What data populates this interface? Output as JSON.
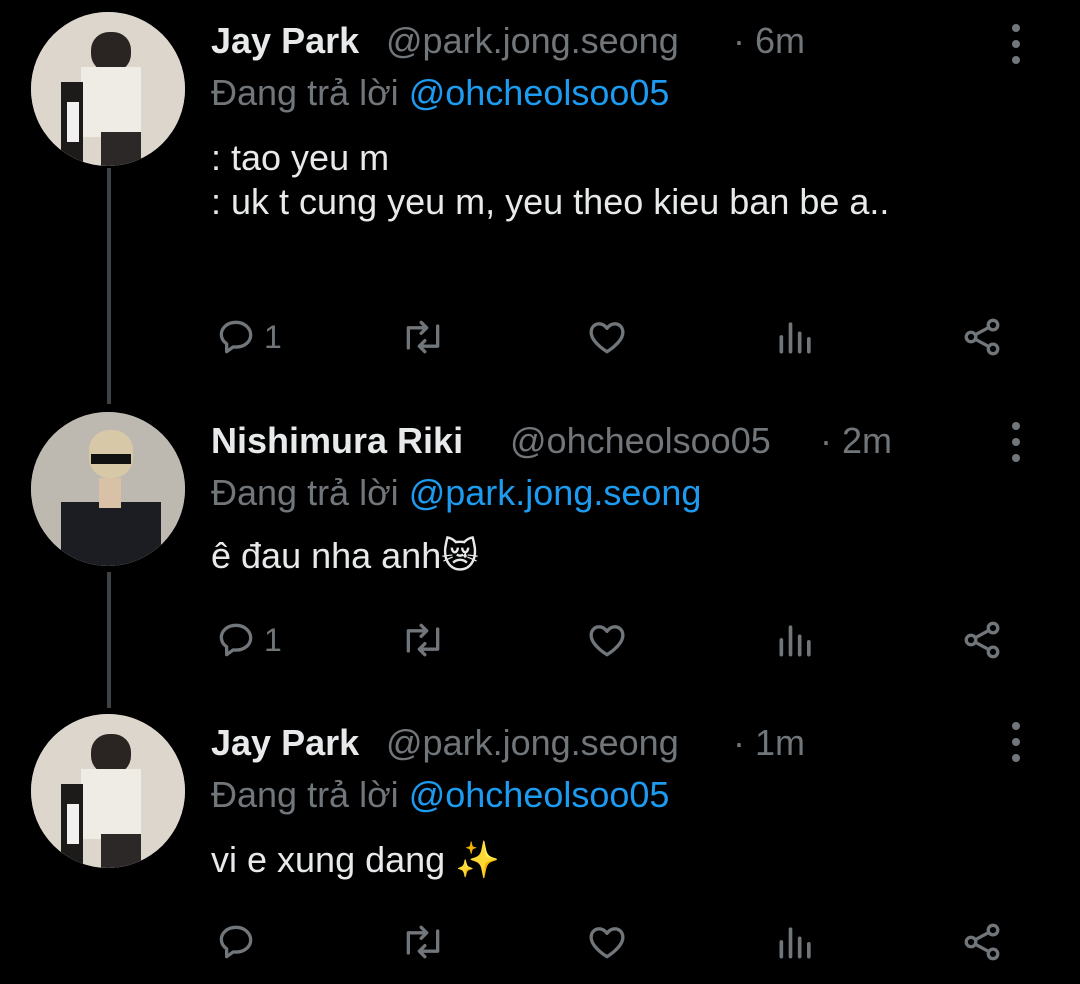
{
  "tweets": [
    {
      "display_name": "Jay Park",
      "handle": "@park.jong.seong",
      "time": "· 6m",
      "reply_prefix": "Đang trả lời",
      "reply_to": "@ohcheolsoo05",
      "text": ": tao yeu m\n: uk t cung yeu m, yeu theo kieu ban be a..",
      "reply_count": "1"
    },
    {
      "display_name": "Nishimura Riki",
      "handle": "@ohcheolsoo05",
      "time": "· 2m",
      "reply_prefix": "Đang trả lời",
      "reply_to": "@park.jong.seong",
      "text": "ê đau nha anh😿",
      "reply_count": "1"
    },
    {
      "display_name": "Jay Park",
      "handle": "@park.jong.seong",
      "time": "· 1m",
      "reply_prefix": "Đang trả lời",
      "reply_to": "@ohcheolsoo05",
      "text": "vi e xung dang ✨",
      "reply_count": ""
    }
  ],
  "icons": {
    "reply": "reply-icon",
    "retweet": "retweet-icon",
    "like": "heart-icon",
    "views": "analytics-icon",
    "share": "share-icon",
    "more": "more-vertical-icon"
  },
  "colors": {
    "background": "#000000",
    "text": "#e7e9ea",
    "secondary": "#71767b",
    "mention": "#1d9bf0",
    "thread_line": "#3d4247"
  }
}
